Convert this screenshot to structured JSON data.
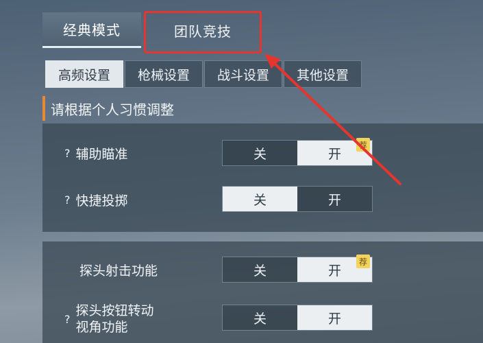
{
  "top_tabs": {
    "classic": "经典模式",
    "team": "团队竞技"
  },
  "sub_tabs": [
    "高频设置",
    "枪械设置",
    "战斗设置",
    "其他设置"
  ],
  "section_title": "请根据个人习惯调整",
  "rows": [
    {
      "label": "辅助瞄准",
      "help": "?",
      "off": "关",
      "on": "开",
      "state": "on",
      "badge": "荐"
    },
    {
      "label": "快捷投掷",
      "help": "?",
      "off": "关",
      "on": "开",
      "state": "off"
    },
    {
      "label": "探头射击功能",
      "off": "关",
      "on": "开",
      "state": "on",
      "badge": "荐"
    },
    {
      "label_line1": "探头按钮转动",
      "label_line2": "视角功能",
      "help": "?",
      "off": "关",
      "on": "开",
      "state": "on"
    }
  ],
  "colors": {
    "highlight": "#e5352f",
    "accent": "#e68a3a",
    "badge": "#f2d35c"
  }
}
